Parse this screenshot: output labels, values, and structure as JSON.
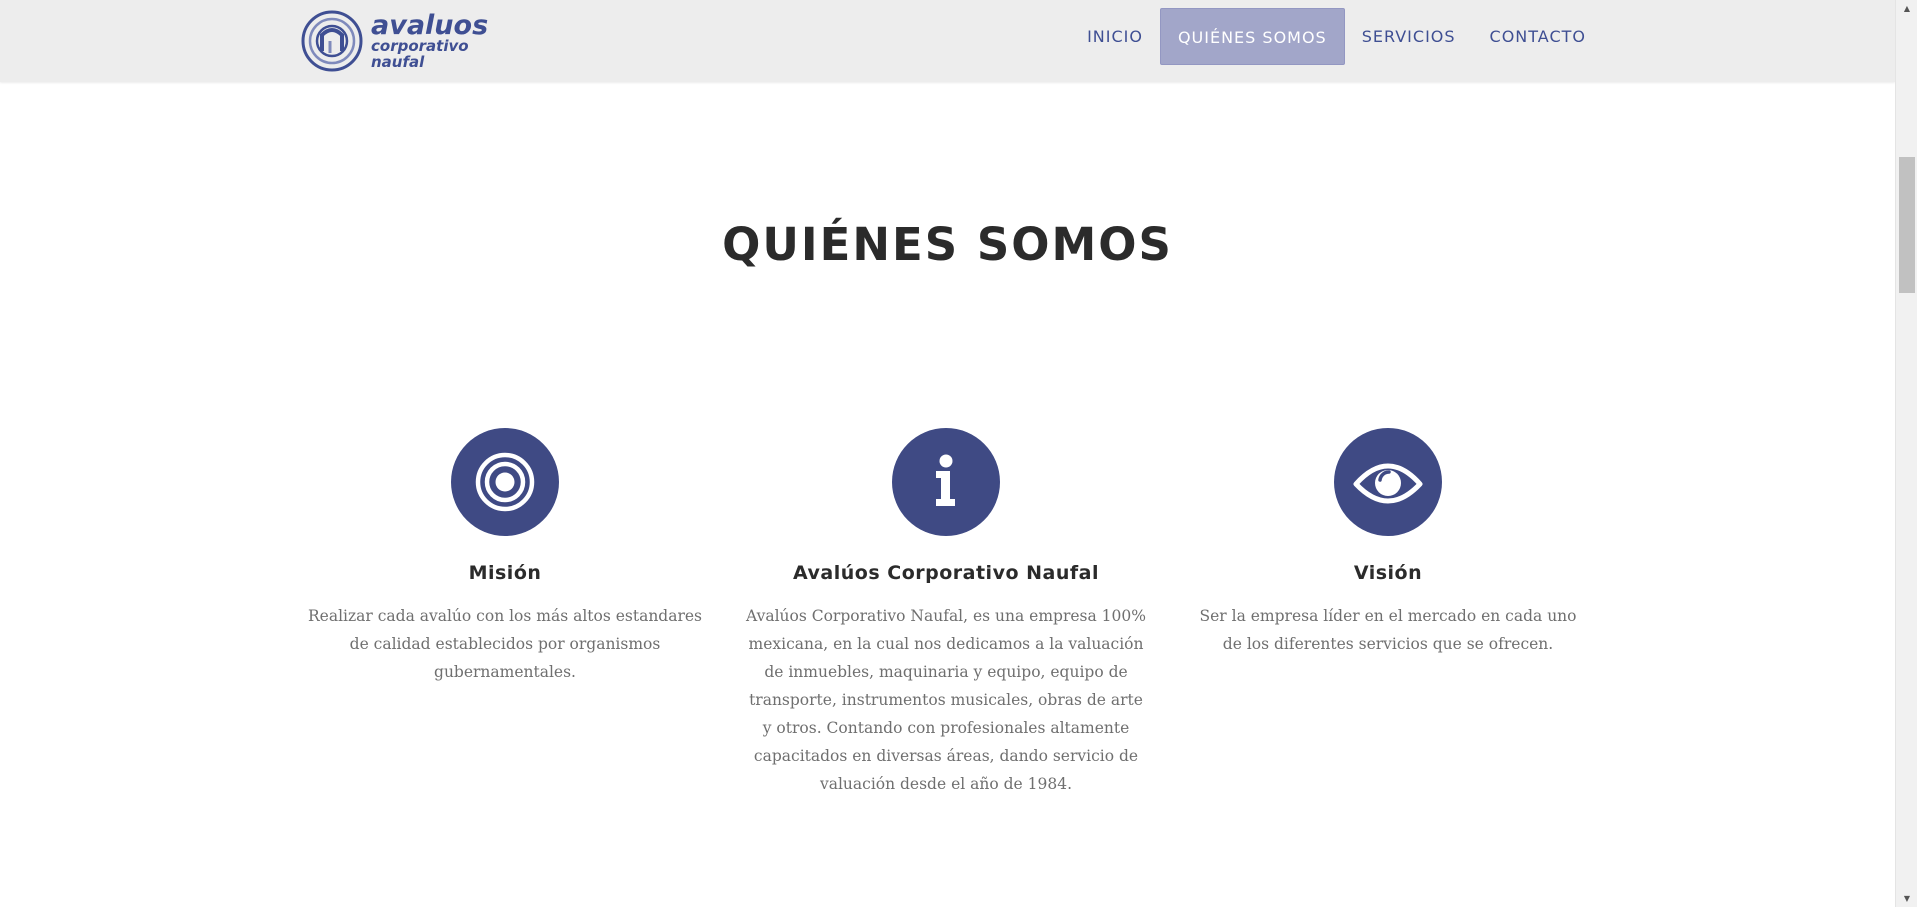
{
  "brand": {
    "line1": "avaluos",
    "line2": "corporativo",
    "line3": "naufal",
    "color": "#3f4f93"
  },
  "nav": {
    "items": [
      {
        "label": "INICIO",
        "active": false
      },
      {
        "label": "QUIÉNES SOMOS",
        "active": true
      },
      {
        "label": "SERVICIOS",
        "active": false
      },
      {
        "label": "CONTACTO",
        "active": false
      }
    ],
    "active_bg": "#a2a6c9"
  },
  "section": {
    "title": "QUIÉNES SOMOS"
  },
  "features": [
    {
      "icon": "target-icon",
      "title": "Misión",
      "text": "Realizar cada avalúo con los más altos estandares de calidad establecidos por organismos gubernamentales."
    },
    {
      "icon": "info-icon",
      "title": "Avalúos Corporativo Naufal",
      "text": "Avalúos Corporativo Naufal, es una empresa 100% mexicana, en la cual nos dedicamos a la valuación de inmuebles, maquinaria y equipo, equipo de transporte, instrumentos musicales, obras de arte y otros. Contando con profesionales altamente capacitados en diversas áreas, dando servicio de valuación desde el año de 1984."
    },
    {
      "icon": "eye-icon",
      "title": "Visión",
      "text": "Ser la empresa líder en el mercado en cada uno de los diferentes servicios que se ofrecen."
    }
  ],
  "colors": {
    "icon_circle": "#3f4a84",
    "heading": "#2b2b2b",
    "body_text": "#6f6f6f",
    "navbar_bg": "#ededed"
  }
}
